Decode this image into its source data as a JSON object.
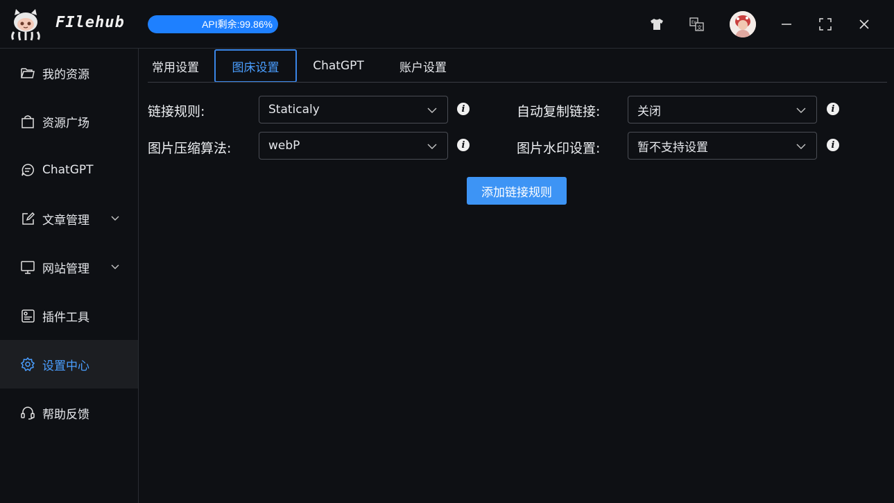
{
  "app": {
    "title": "FIlehub",
    "api_label": "API剩余:99.86%",
    "api_percent": 99.86
  },
  "titlebar": {
    "icons": [
      "tshirt-icon",
      "translate-icon",
      "avatar",
      "minimize-icon",
      "maximize-icon",
      "close-icon"
    ]
  },
  "sidebar": {
    "items": [
      {
        "label": "我的资源",
        "icon": "folder-icon"
      },
      {
        "label": "资源广场",
        "icon": "shopping-bag-icon"
      },
      {
        "label": "ChatGPT",
        "icon": "chat-bubble-icon"
      },
      {
        "label": "文章管理",
        "icon": "edit-icon",
        "expandable": true
      },
      {
        "label": "网站管理",
        "icon": "monitor-icon",
        "expandable": true
      },
      {
        "label": "插件工具",
        "icon": "plugin-icon"
      },
      {
        "label": "设置中心",
        "icon": "gear-icon",
        "active": true
      },
      {
        "label": "帮助反馈",
        "icon": "headset-icon"
      }
    ]
  },
  "tabs": [
    {
      "label": "常用设置"
    },
    {
      "label": "图床设置",
      "active": true
    },
    {
      "label": "ChatGPT"
    },
    {
      "label": "账户设置"
    }
  ],
  "form": {
    "link_rule": {
      "label": "链接规则:",
      "value": "Staticaly"
    },
    "auto_copy": {
      "label": "自动复制链接:",
      "value": "关闭"
    },
    "compress": {
      "label": "图片压缩算法:",
      "value": "webP"
    },
    "watermark": {
      "label": "图片水印设置:",
      "value": "暂不支持设置"
    },
    "add_button": "添加链接规则"
  },
  "colors": {
    "accent": "#3d94f5",
    "active_text": "#4a9eff",
    "background": "#0e1014"
  }
}
